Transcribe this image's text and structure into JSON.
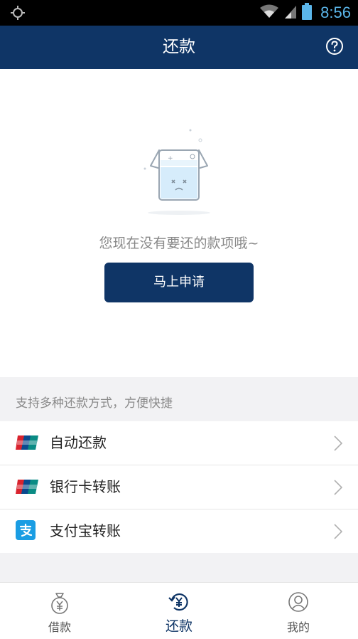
{
  "status_bar": {
    "time": "8:56"
  },
  "header": {
    "title": "还款",
    "help_icon": "help-circle-icon"
  },
  "empty_state": {
    "message": "您现在没有要还的款项哦~",
    "apply_button": "马上申请"
  },
  "repay_methods": {
    "hint": "支持多种还款方式，方便快捷",
    "items": [
      {
        "label": "自动还款",
        "icon": "unionpay-icon"
      },
      {
        "label": "银行卡转账",
        "icon": "unionpay-icon"
      },
      {
        "label": "支付宝转账",
        "icon": "alipay-icon"
      }
    ]
  },
  "tabs": [
    {
      "label": "借款",
      "icon": "money-bag-icon",
      "active": false
    },
    {
      "label": "还款",
      "icon": "repay-cycle-icon",
      "active": true
    },
    {
      "label": "我的",
      "icon": "user-icon",
      "active": false
    }
  ],
  "colors": {
    "brand": "#0f3566",
    "status_accent": "#5bb6ea"
  }
}
